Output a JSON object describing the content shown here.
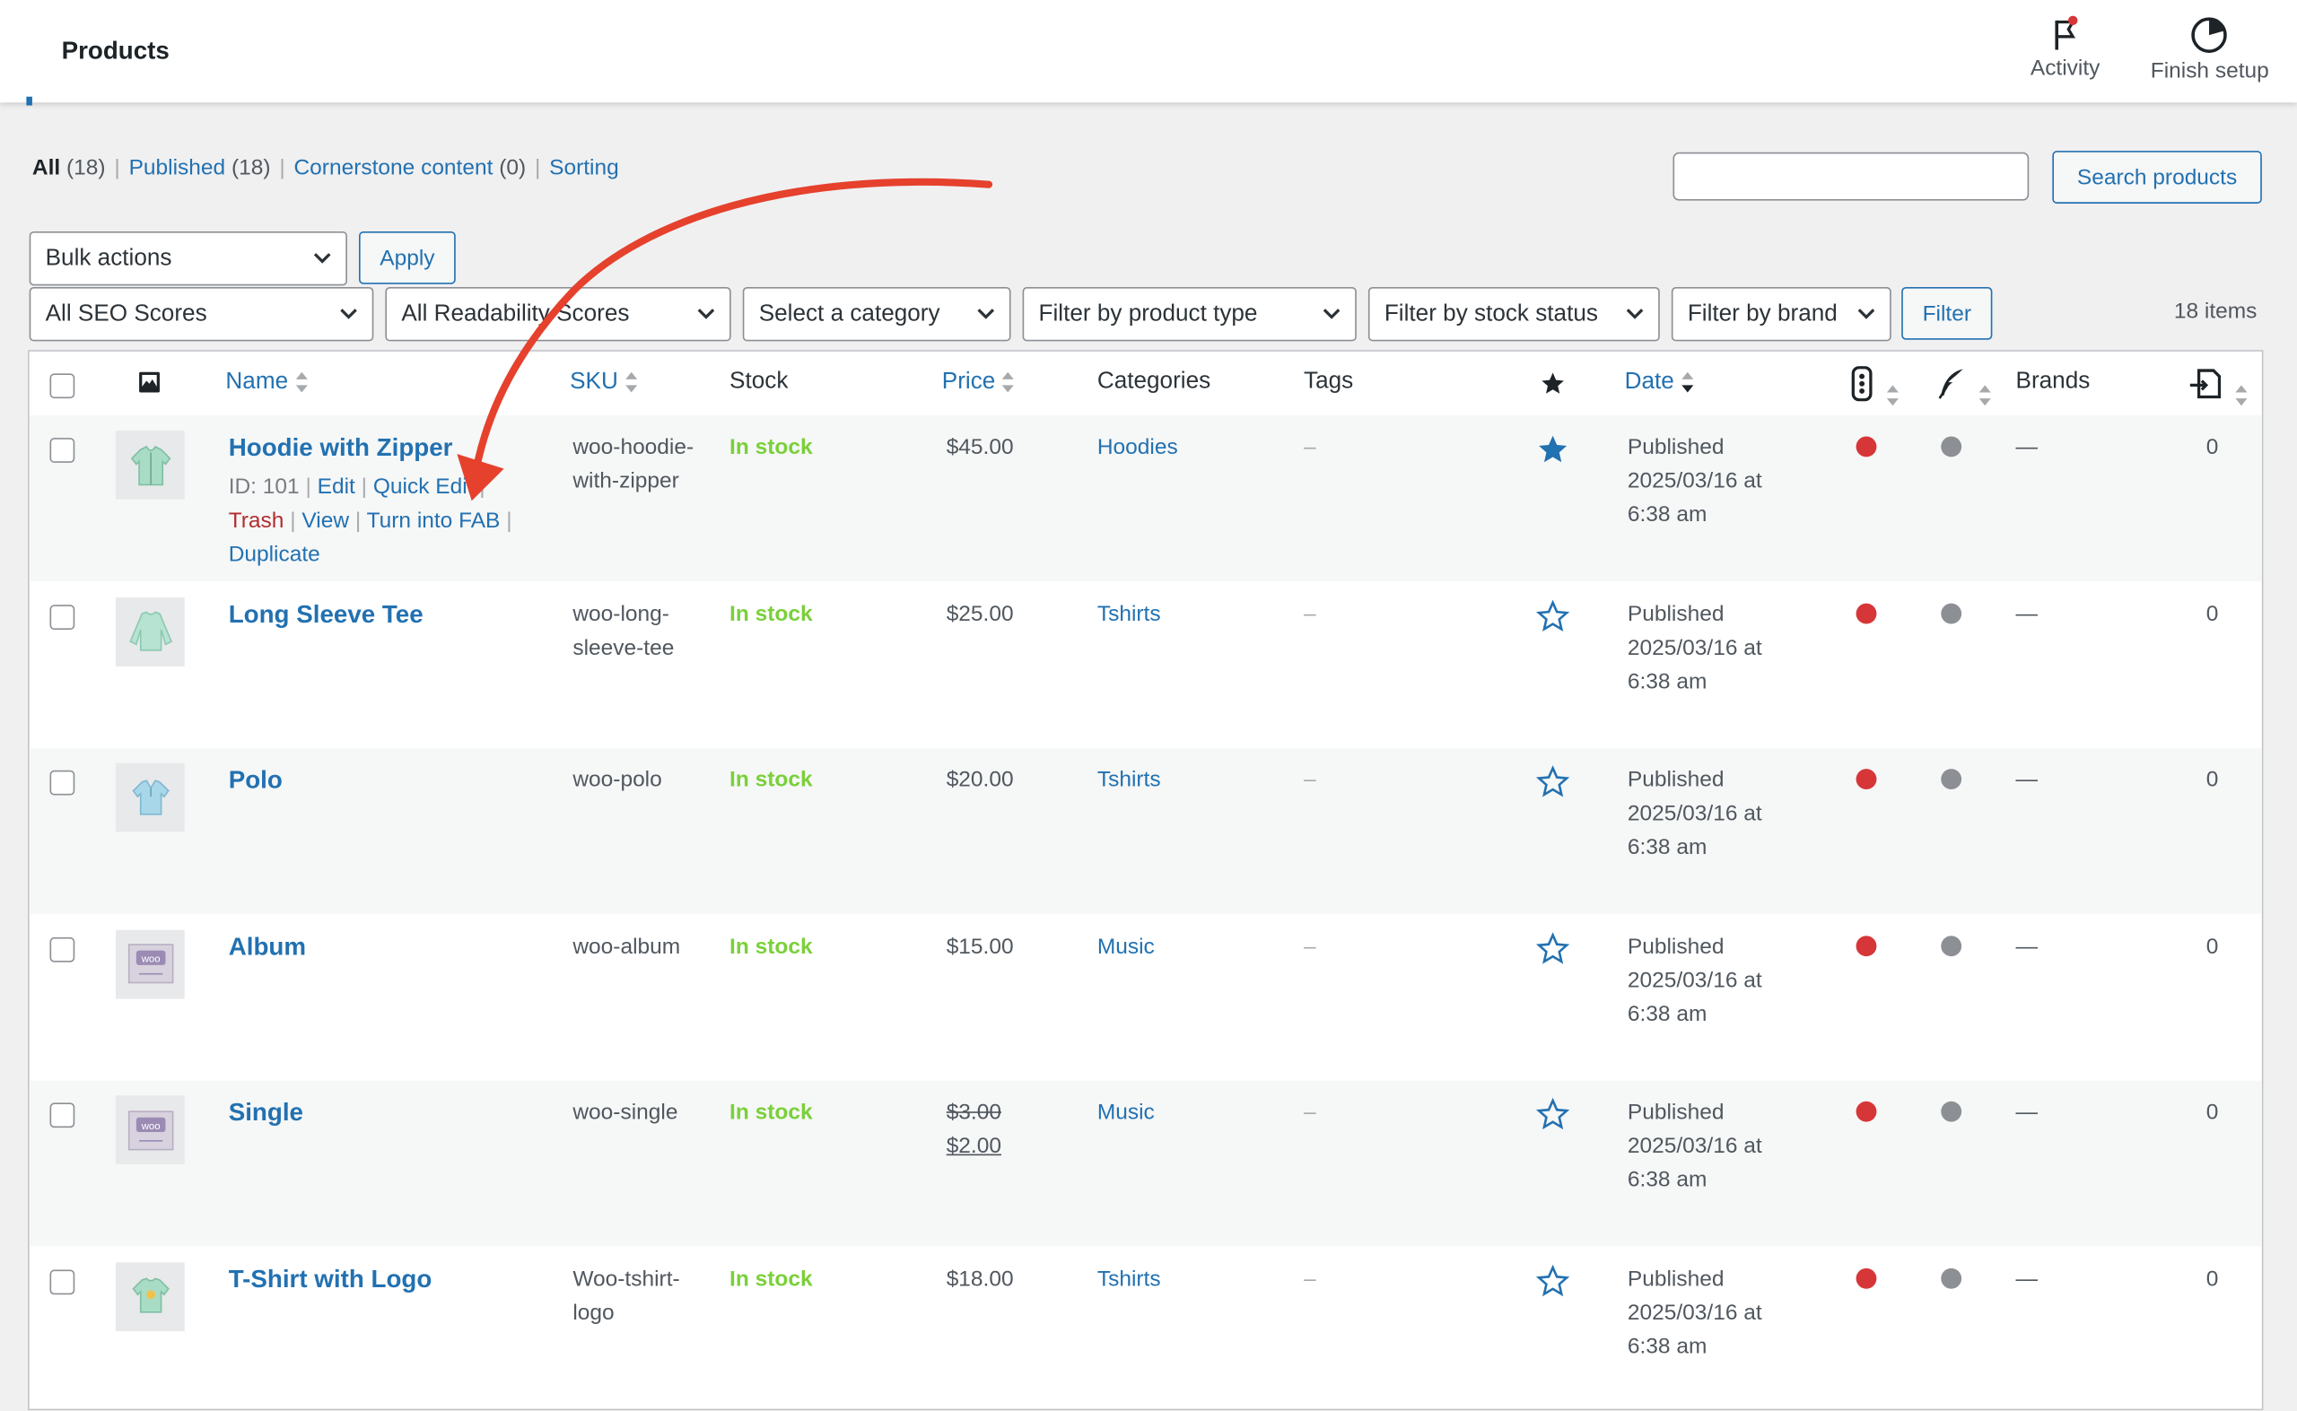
{
  "header": {
    "title": "Products",
    "activity_label": "Activity",
    "finish_setup_label": "Finish setup"
  },
  "views": [
    {
      "label": "All",
      "count": "(18)",
      "current": true
    },
    {
      "label": "Published",
      "count": "(18)"
    },
    {
      "label": "Cornerstone content",
      "count": "(0)"
    },
    {
      "label": "Sorting",
      "count": ""
    }
  ],
  "search": {
    "button_label": "Search products",
    "value": ""
  },
  "bulk": {
    "selected": "Bulk actions",
    "apply_label": "Apply"
  },
  "filters": {
    "seo": "All SEO Scores",
    "readability": "All Readability Scores",
    "category": "Select a category",
    "product_type": "Filter by product type",
    "stock_status": "Filter by stock status",
    "brand": "Filter by brand",
    "filter_label": "Filter"
  },
  "items_count": "18 items",
  "columns": {
    "name": "Name",
    "sku": "SKU",
    "stock": "Stock",
    "price": "Price",
    "categories": "Categories",
    "tags": "Tags",
    "date": "Date",
    "brands": "Brands"
  },
  "row_actions": {
    "id": "ID: 101",
    "edit": "Edit",
    "quick_edit": "Quick Edit",
    "trash": "Trash",
    "view": "View",
    "fab": "Turn into FAB",
    "duplicate": "Duplicate"
  },
  "products": [
    {
      "name": "Hoodie with Zipper",
      "sku": "woo-hoodie-with-zipper",
      "stock": "In stock",
      "price": "$45.00",
      "category": "Hoodies",
      "tags": "–",
      "featured": true,
      "date_status": "Published",
      "date_value": "2025/03/16 at",
      "date_time": "6:38 am",
      "brands": "—",
      "count": "0",
      "img": "hoodie"
    },
    {
      "name": "Long Sleeve Tee",
      "sku": "woo-long-sleeve-tee",
      "stock": "In stock",
      "price": "$25.00",
      "category": "Tshirts",
      "tags": "–",
      "featured": false,
      "date_status": "Published",
      "date_value": "2025/03/16 at",
      "date_time": "6:38 am",
      "brands": "—",
      "count": "0",
      "img": "longsleeve"
    },
    {
      "name": "Polo",
      "sku": "woo-polo",
      "stock": "In stock",
      "price": "$20.00",
      "category": "Tshirts",
      "tags": "–",
      "featured": false,
      "date_status": "Published",
      "date_value": "2025/03/16 at",
      "date_time": "6:38 am",
      "brands": "—",
      "count": "0",
      "img": "polo"
    },
    {
      "name": "Album",
      "sku": "woo-album",
      "stock": "In stock",
      "price": "$15.00",
      "category": "Music",
      "tags": "–",
      "featured": false,
      "date_status": "Published",
      "date_value": "2025/03/16 at",
      "date_time": "6:38 am",
      "brands": "—",
      "count": "0",
      "img": "woo"
    },
    {
      "name": "Single",
      "sku": "woo-single",
      "stock": "In stock",
      "price_regular": "$3.00",
      "price": "$2.00",
      "category": "Music",
      "tags": "–",
      "featured": false,
      "date_status": "Published",
      "date_value": "2025/03/16 at",
      "date_time": "6:38 am",
      "brands": "—",
      "count": "0",
      "img": "woo"
    },
    {
      "name": "T-Shirt with Logo",
      "sku": "Woo-tshirt-logo",
      "stock": "In stock",
      "price": "$18.00",
      "category": "Tshirts",
      "tags": "–",
      "featured": false,
      "date_status": "Published",
      "date_value": "2025/03/16 at",
      "date_time": "6:38 am",
      "brands": "—",
      "count": "0",
      "img": "tshirt"
    }
  ],
  "colors": {
    "link": "#2271b1",
    "in_stock": "#7ad03a",
    "seo_dot": "#d63638",
    "readability_dot": "#8c8f94",
    "arrow": "#e5412d",
    "trash": "#b32d2e"
  }
}
